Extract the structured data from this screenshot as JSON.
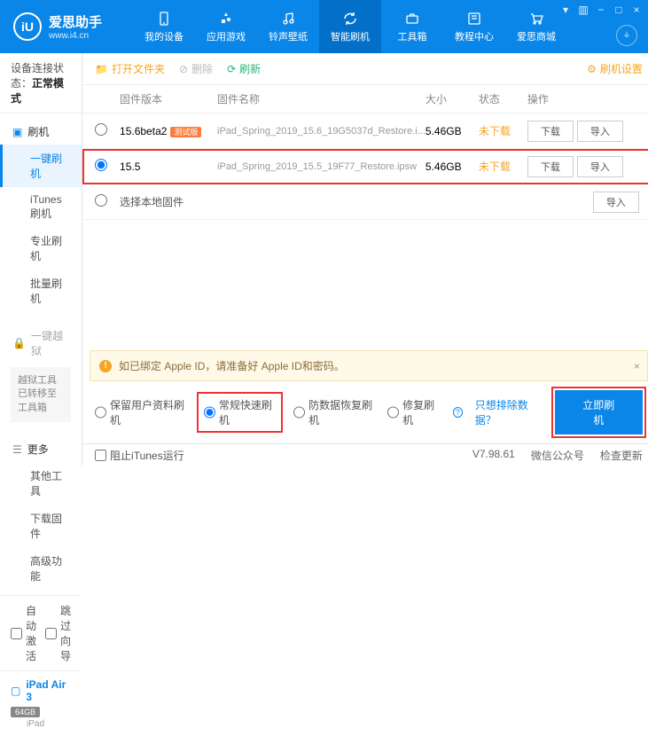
{
  "header": {
    "logo_letter": "iU",
    "title": "爱思助手",
    "subtitle": "www.i4.cn",
    "nav": [
      {
        "label": "我的设备"
      },
      {
        "label": "应用游戏"
      },
      {
        "label": "铃声壁纸"
      },
      {
        "label": "智能刷机"
      },
      {
        "label": "工具箱"
      },
      {
        "label": "教程中心"
      },
      {
        "label": "爱思商城"
      }
    ]
  },
  "sidebar": {
    "conn_label": "设备连接状态：",
    "conn_value": "正常模式",
    "flash_head": "刷机",
    "items": [
      "一键刷机",
      "iTunes刷机",
      "专业刷机",
      "批量刷机"
    ],
    "jailbreak_head": "一键越狱",
    "jailbreak_note": "越狱工具已转移至工具箱",
    "more_head": "更多",
    "more_items": [
      "其他工具",
      "下载固件",
      "高级功能"
    ],
    "auto_activate": "自动激活",
    "skip_guide": "跳过向导",
    "device_name": "iPad Air 3",
    "device_storage": "64GB",
    "device_type": "iPad",
    "block_itunes": "阻止iTunes运行"
  },
  "toolbar": {
    "open": "打开文件夹",
    "delete": "删除",
    "refresh": "刷新",
    "settings": "刷机设置"
  },
  "table": {
    "h_version": "固件版本",
    "h_name": "固件名称",
    "h_size": "大小",
    "h_status": "状态",
    "h_ops": "操作",
    "rows": [
      {
        "ver": "15.6beta2",
        "badge": "测试版",
        "name": "iPad_Spring_2019_15.6_19G5037d_Restore.i...",
        "size": "5.46GB",
        "status": "未下载"
      },
      {
        "ver": "15.5",
        "badge": "",
        "name": "iPad_Spring_2019_15.5_19F77_Restore.ipsw",
        "size": "5.46GB",
        "status": "未下载"
      }
    ],
    "local": "选择本地固件",
    "download": "下载",
    "import": "导入"
  },
  "warning": "如已绑定 Apple ID，请准备好 Apple ID和密码。",
  "options": {
    "keep": "保留用户资料刷机",
    "normal": "常规快速刷机",
    "antirecovery": "防数据恢复刷机",
    "repair": "修复刷机",
    "exclude": "只想排除数据？",
    "flash": "立即刷机"
  },
  "footer": {
    "block": "阻止iTunes运行",
    "version": "V7.98.61",
    "wechat": "微信公众号",
    "update": "检查更新"
  }
}
